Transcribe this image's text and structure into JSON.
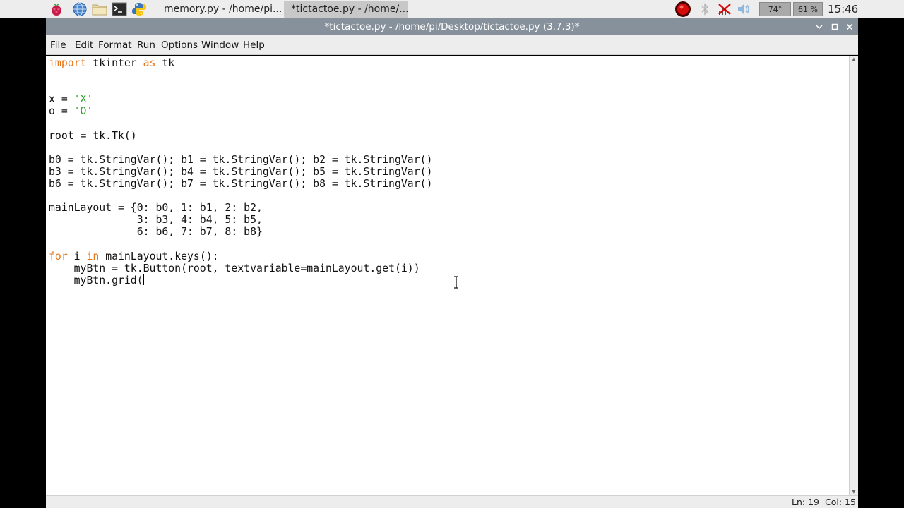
{
  "taskbar": {
    "launchers": [
      {
        "icon": "raspberry-pi-menu-icon"
      },
      {
        "icon": "web-browser-icon"
      },
      {
        "icon": "file-manager-icon"
      },
      {
        "icon": "terminal-icon"
      },
      {
        "icon": "python-idle-icon"
      }
    ],
    "tasks": [
      {
        "label": "memory.py - /home/pi...",
        "icon": "python-file-icon",
        "active": false
      },
      {
        "label": "*tictactoe.py - /home/...",
        "icon": "python-file-icon",
        "active": true
      }
    ],
    "tray": {
      "cpu_temp": "74°",
      "cpu_usage": "61 %",
      "clock": "15:46"
    }
  },
  "window": {
    "title": "*tictactoe.py - /home/pi/Desktop/tictactoe.py (3.7.3)*",
    "controls": [
      "minimize",
      "maximize",
      "close"
    ]
  },
  "menu": {
    "file": "File",
    "edit": "Edit",
    "format": "Format",
    "run": "Run",
    "options": "Options",
    "window": "Window",
    "help": "Help"
  },
  "editor": {
    "lines": [
      "import tkinter as tk",
      "",
      "",
      "x = 'X'",
      "o = 'O'",
      "",
      "root = tk.Tk()",
      "",
      "b0 = tk.StringVar(); b1 = tk.StringVar(); b2 = tk.StringVar()",
      "b3 = tk.StringVar(); b4 = tk.StringVar(); b5 = tk.StringVar()",
      "b6 = tk.StringVar(); b7 = tk.StringVar(); b8 = tk.StringVar()",
      "",
      "mainLayout = {0: b0, 1: b1, 2: b2,",
      "              3: b3, 4: b4, 5: b5,",
      "              6: b6, 7: b7, 8: b8}",
      "",
      "for i in mainLayout.keys():",
      "    myBtn = tk.Button(root, textvariable=mainLayout.get(i))",
      "    myBtn.grid("
    ],
    "colors": {
      "keyword": "#e6751a",
      "string": "#2aa12a",
      "text": "#111111"
    }
  },
  "status": {
    "line": "Ln: 19",
    "col": "Col: 15"
  }
}
